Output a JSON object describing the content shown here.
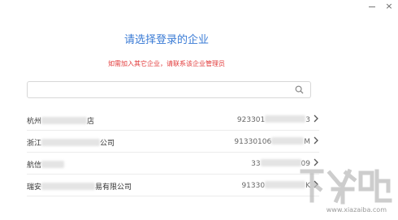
{
  "window": {
    "close_glyph": "×"
  },
  "page": {
    "title": "请选择登录的企业",
    "notice": "如需加入其它企业，请联系该企业管理员"
  },
  "search": {
    "value": "",
    "placeholder": "",
    "icon": "search-icon"
  },
  "companies": [
    {
      "name_start": "杭州",
      "name_end": "店",
      "code_start": "923301",
      "code_end": "3"
    },
    {
      "name_start": "浙江",
      "name_end": "公司",
      "code_start": "91330106",
      "code_end": "M"
    },
    {
      "name_start": "航信",
      "name_end": "",
      "code_start": "33",
      "code_end": "09"
    },
    {
      "name_start": "瑞安",
      "name_end": "易有限公司",
      "code_start": "91330",
      "code_end": "K"
    }
  ],
  "watermark": {
    "logo_text": "下载吧",
    "url": "www.xiazaiba.com"
  }
}
